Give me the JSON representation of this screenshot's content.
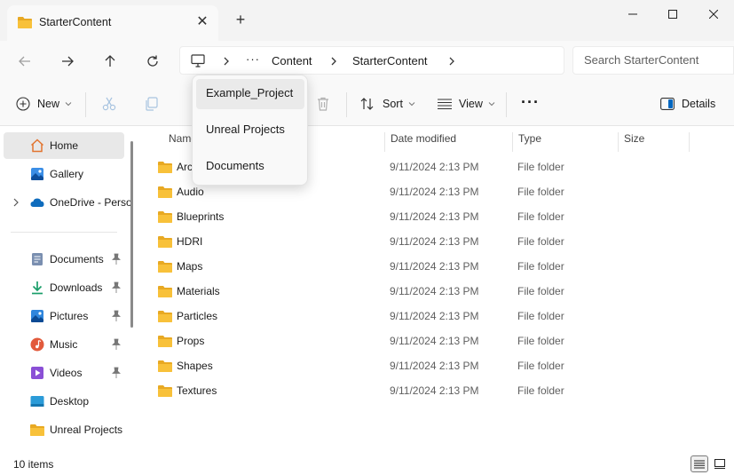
{
  "window": {
    "tab_title": "StarterContent",
    "close_tab_glyph": "✕",
    "new_tab_glyph": "+"
  },
  "address": {
    "overflow_glyph": "···",
    "breadcrumbs": [
      "Content",
      "StarterContent"
    ],
    "search_placeholder": "Search StarterContent"
  },
  "commands": {
    "new_label": "New",
    "sort_label": "Sort",
    "view_label": "View",
    "more_glyph": "···",
    "details_label": "Details"
  },
  "dropdown": {
    "items": [
      "Example_Project",
      "Unreal Projects",
      "Documents"
    ]
  },
  "nav": {
    "home": "Home",
    "gallery": "Gallery",
    "onedrive": "OneDrive - Perso",
    "documents": "Documents",
    "downloads": "Downloads",
    "pictures": "Pictures",
    "music": "Music",
    "videos": "Videos",
    "desktop": "Desktop",
    "unreal_projects": "Unreal Projects"
  },
  "columns": {
    "name": "Name",
    "date": "Date modified",
    "type": "Type",
    "size": "Size"
  },
  "files": [
    {
      "name": "Architecture",
      "date": "9/11/2024 2:13 PM",
      "type": "File folder"
    },
    {
      "name": "Audio",
      "date": "9/11/2024 2:13 PM",
      "type": "File folder"
    },
    {
      "name": "Blueprints",
      "date": "9/11/2024 2:13 PM",
      "type": "File folder"
    },
    {
      "name": "HDRI",
      "date": "9/11/2024 2:13 PM",
      "type": "File folder"
    },
    {
      "name": "Maps",
      "date": "9/11/2024 2:13 PM",
      "type": "File folder"
    },
    {
      "name": "Materials",
      "date": "9/11/2024 2:13 PM",
      "type": "File folder"
    },
    {
      "name": "Particles",
      "date": "9/11/2024 2:13 PM",
      "type": "File folder"
    },
    {
      "name": "Props",
      "date": "9/11/2024 2:13 PM",
      "type": "File folder"
    },
    {
      "name": "Shapes",
      "date": "9/11/2024 2:13 PM",
      "type": "File folder"
    },
    {
      "name": "Textures",
      "date": "9/11/2024 2:13 PM",
      "type": "File folder"
    }
  ],
  "status": {
    "item_count": "10 items"
  },
  "colors": {
    "folder": "#f8c13a",
    "folder_dark": "#e8a923",
    "accent": "#0067c0"
  }
}
